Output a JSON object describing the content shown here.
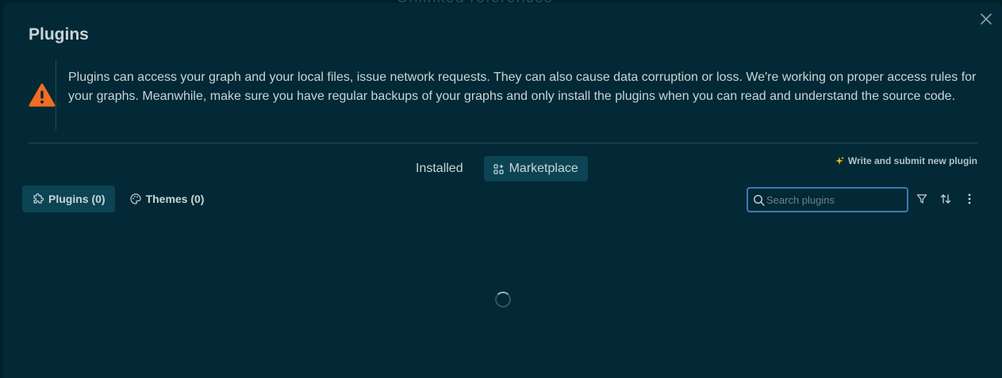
{
  "background_title": "Unlinked references",
  "dialog": {
    "title": "Plugins",
    "warning": "Plugins can access your graph and your local files, issue network requests. They can also cause data corruption or loss. We're working on proper access rules for your graphs. Meanwhile, make sure you have regular backups of your graphs and only install the plugins when you can read and understand the source code.",
    "write_link": "Write and submit new plugin",
    "main_tabs": [
      {
        "label": "Installed",
        "active": false
      },
      {
        "label": "Marketplace",
        "active": true
      }
    ],
    "sub_tabs": [
      {
        "label": "Plugins (0)",
        "icon": "puzzle-icon",
        "active": true
      },
      {
        "label": "Themes (0)",
        "icon": "palette-icon",
        "active": false
      }
    ],
    "search": {
      "placeholder": "Search plugins",
      "value": ""
    },
    "toolbar": [
      "filter-icon",
      "sort-icon",
      "more-vertical-icon"
    ],
    "status": "loading"
  },
  "colors": {
    "background": "#00212a",
    "panel": "#022935",
    "active_tab": "#0c4453",
    "warning_orange": "#f26d21",
    "search_border": "#3f79b5",
    "sparkle": "#f5c518"
  }
}
